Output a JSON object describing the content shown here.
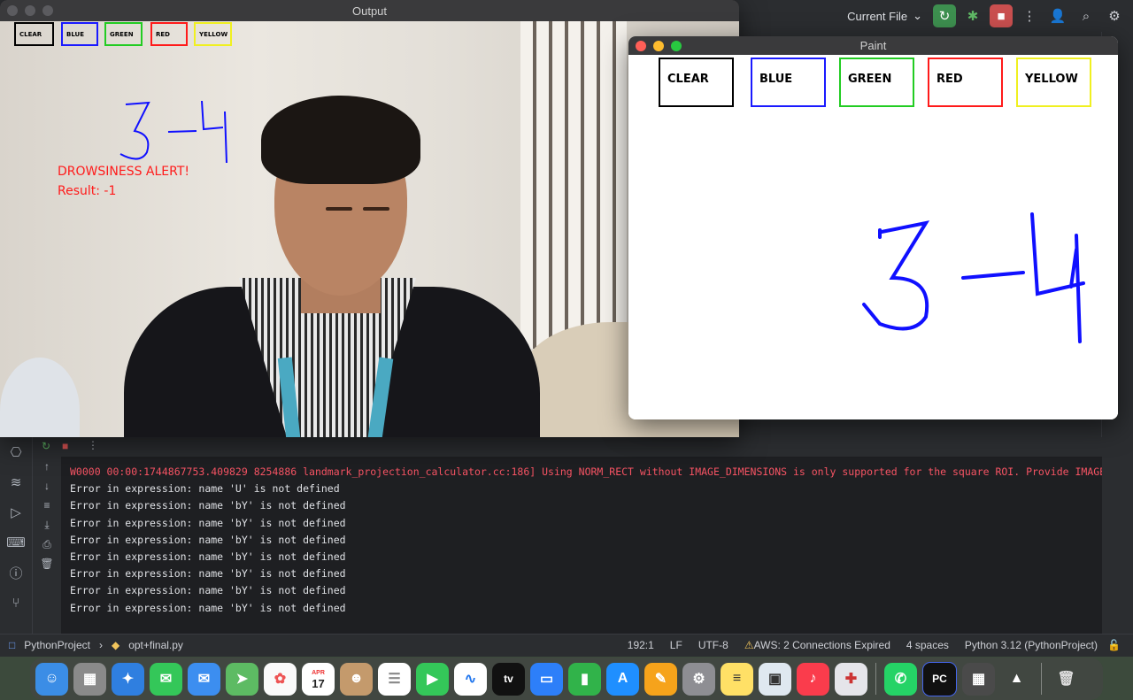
{
  "ide": {
    "run_config": "Current File",
    "project": "PythonProject",
    "file": "opt+final.py",
    "status": {
      "position": "192:1",
      "line_sep": "LF",
      "encoding": "UTF-8",
      "aws": "AWS: 2 Connections Expired",
      "indent": "4 spaces",
      "interpreter": "Python 3.12 (PythonProject)"
    },
    "console": {
      "warning": "W0000 00:00:1744867753.409829 8254886 landmark_projection_calculator.cc:186] Using NORM_RECT without IMAGE_DIMENSIONS is only supported for the square ROI. Provide IMAGE_DI",
      "lines": [
        "Error in expression: name 'U' is not defined",
        "Error in expression: name 'bY' is not defined",
        "Error in expression: name 'bY' is not defined",
        "Error in expression: name 'bY' is not defined",
        "Error in expression: name 'bY' is not defined",
        "Error in expression: name 'bY' is not defined",
        "Error in expression: name 'bY' is not defined",
        "Error in expression: name 'bY' is not defined"
      ]
    }
  },
  "output_window": {
    "title": "Output",
    "buttons": [
      "CLEAR",
      "BLUE",
      "GREEN",
      "RED",
      "YELLOW"
    ],
    "alert": "DROWSINESS ALERT!",
    "result": "Result: -1"
  },
  "paint_window": {
    "title": "Paint",
    "buttons": [
      "CLEAR",
      "BLUE",
      "GREEN",
      "RED",
      "YELLOW"
    ]
  },
  "colors": {
    "clear": "#000000",
    "blue": "#1a1aff",
    "green": "#22cc22",
    "red": "#ff1a1a",
    "yellow": "#f0f020",
    "stroke": "#1010ff"
  },
  "dock": {
    "calendar_month": "APR",
    "calendar_day": "17",
    "tv_label": "tv",
    "pycharm_label": "PC"
  }
}
